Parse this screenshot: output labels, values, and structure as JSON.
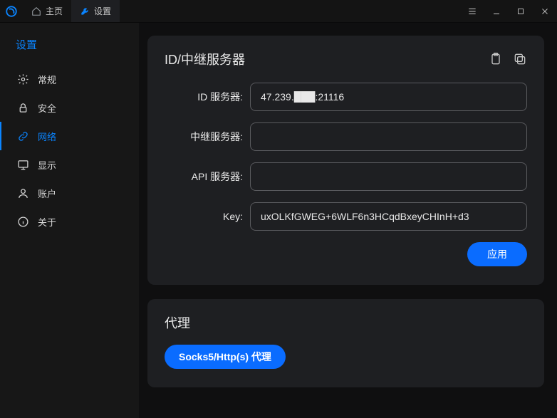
{
  "titlebar": {
    "tabs": [
      {
        "label": "主页"
      },
      {
        "label": "设置"
      }
    ]
  },
  "sidebar": {
    "title": "设置",
    "items": [
      {
        "label": "常规"
      },
      {
        "label": "安全"
      },
      {
        "label": "网络"
      },
      {
        "label": "显示"
      },
      {
        "label": "账户"
      },
      {
        "label": "关于"
      }
    ]
  },
  "server_card": {
    "title": "ID/中继服务器",
    "labels": {
      "id_server": "ID 服务器:",
      "relay_server": "中继服务器:",
      "api_server": "API 服务器:",
      "key": "Key:"
    },
    "values": {
      "id_server": "47.239.███:21116",
      "relay_server": "",
      "api_server": "",
      "key": "uxOLKfGWEG+6WLF6n3HCqdBxeyCHInH+d3"
    },
    "apply_label": "应用"
  },
  "proxy_card": {
    "title": "代理",
    "button_label": "Socks5/Http(s) 代理"
  },
  "colors": {
    "accent": "#0a84ff"
  }
}
